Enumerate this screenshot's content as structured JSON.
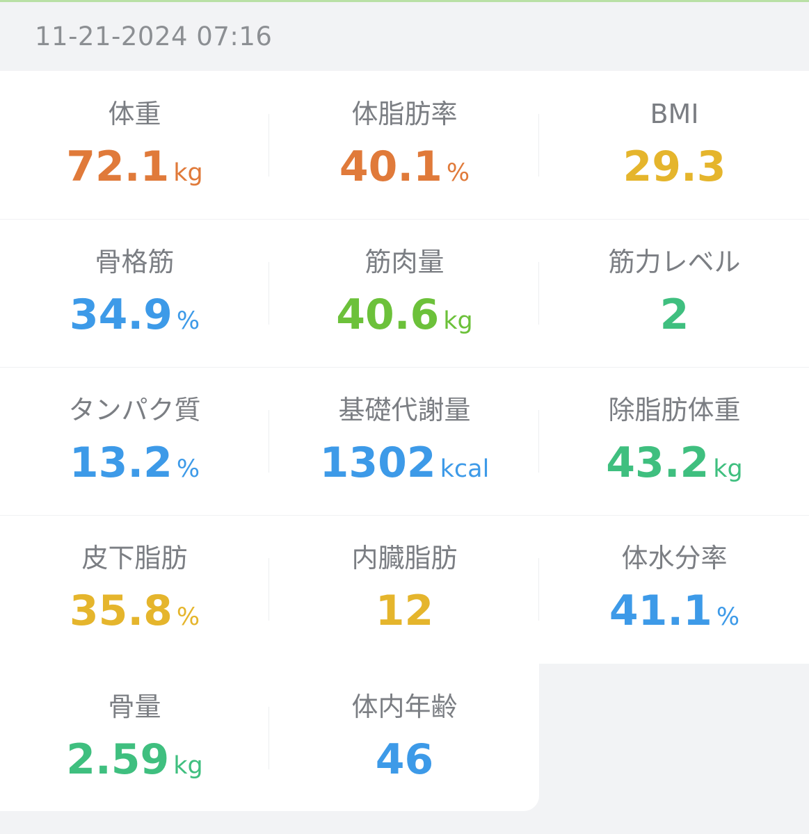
{
  "timestamp": "11-21-2024 07:16",
  "metrics": [
    {
      "label": "体重",
      "value": "72.1",
      "unit": "kg",
      "color": "#e07a3a"
    },
    {
      "label": "体脂肪率",
      "value": "40.1",
      "unit": "%",
      "color": "#e07a3a"
    },
    {
      "label": "BMI",
      "value": "29.3",
      "unit": "",
      "color": "#e5b52c"
    },
    {
      "label": "骨格筋",
      "value": "34.9",
      "unit": "%",
      "color": "#3d9ae8"
    },
    {
      "label": "筋肉量",
      "value": "40.6",
      "unit": "kg",
      "color": "#6cc13a"
    },
    {
      "label": "筋力レベル",
      "value": "2",
      "unit": "",
      "color": "#3fbf7f"
    },
    {
      "label": "タンパク質",
      "value": "13.2",
      "unit": "%",
      "color": "#3d9ae8"
    },
    {
      "label": "基礎代謝量",
      "value": "1302",
      "unit": "kcal",
      "color": "#3d9ae8"
    },
    {
      "label": "除脂肪体重",
      "value": "43.2",
      "unit": "kg",
      "color": "#3fbf7f"
    },
    {
      "label": "皮下脂肪",
      "value": "35.8",
      "unit": "%",
      "color": "#e5b52c"
    },
    {
      "label": "内臓脂肪",
      "value": "12",
      "unit": "",
      "color": "#e5b52c"
    },
    {
      "label": "体水分率",
      "value": "41.1",
      "unit": "%",
      "color": "#3d9ae8"
    },
    {
      "label": "骨量",
      "value": "2.59",
      "unit": "kg",
      "color": "#3fbf7f"
    },
    {
      "label": "体内年齢",
      "value": "46",
      "unit": "",
      "color": "#3d9ae8"
    }
  ]
}
